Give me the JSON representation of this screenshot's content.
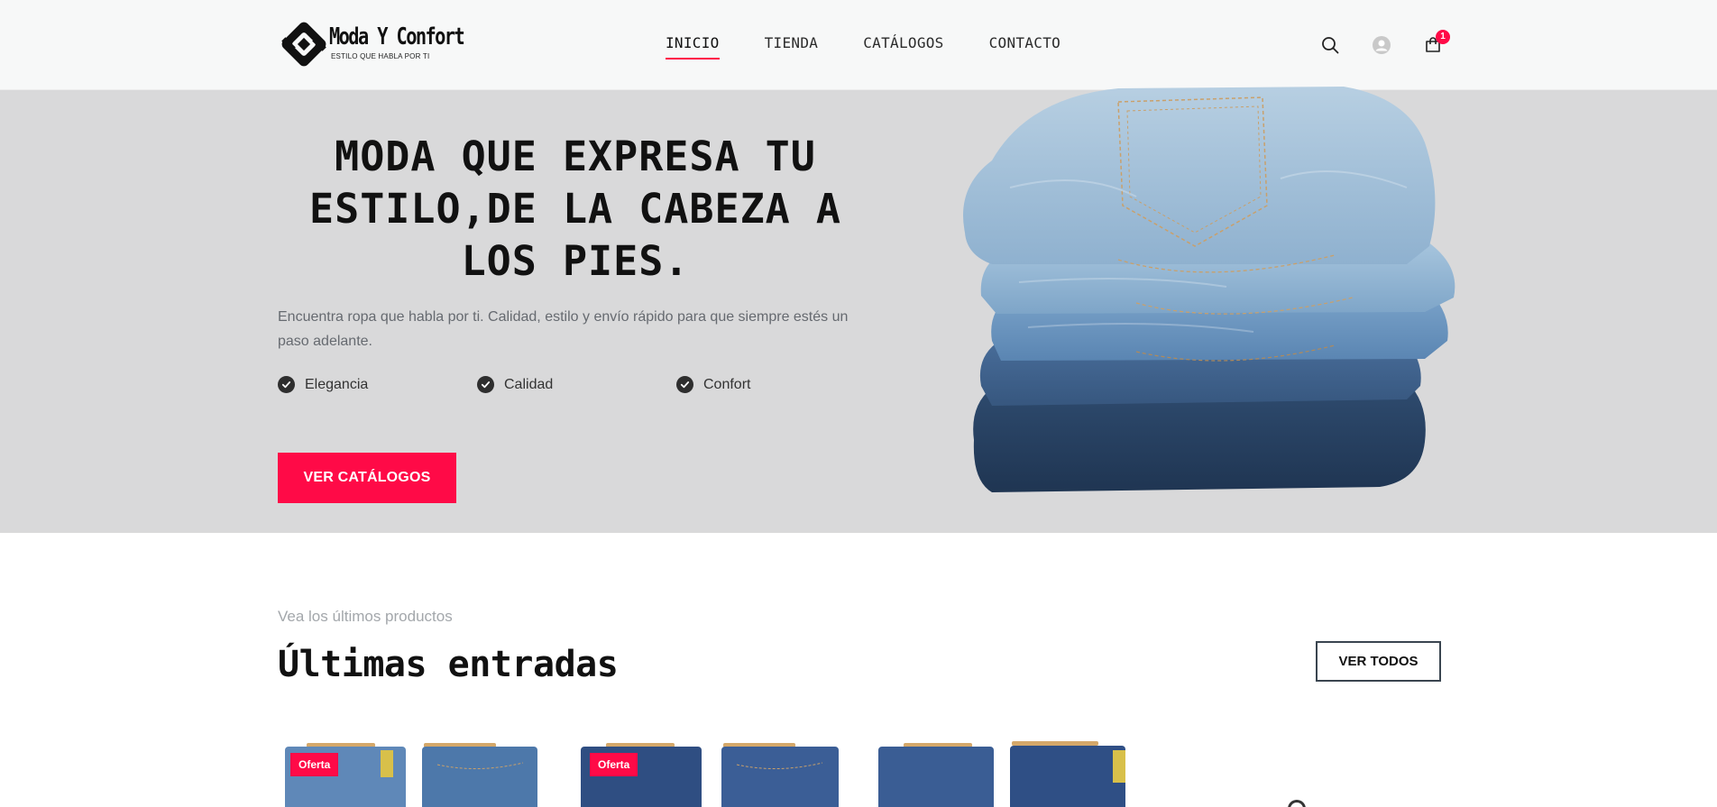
{
  "header": {
    "logo": {
      "title": "Moda Y Confort",
      "tagline": "ESTILO QUE HABLA POR TI"
    },
    "nav": [
      {
        "label": "INICIO",
        "active": true
      },
      {
        "label": "TIENDA",
        "active": false
      },
      {
        "label": "CATÁLOGOS",
        "active": false
      },
      {
        "label": "CONTACTO",
        "active": false
      }
    ],
    "icons": [
      "search-icon",
      "user-avatar-icon",
      "shopping-bag-icon"
    ],
    "cart_count": "1"
  },
  "hero": {
    "title": "MODA QUE EXPRESA TU ESTILO,DE LA CABEZA A LOS PIES.",
    "description": "Encuentra ropa que habla por ti. Calidad, estilo y envío rápido para que siempre estés un paso adelante.",
    "features": [
      "Elegancia",
      "Calidad",
      "Confort"
    ],
    "cta_label": "VER CATÁLOGOS",
    "image": "stacked-jeans"
  },
  "latest": {
    "subtitle": "Vea los últimos productos",
    "title": "Últimas entradas",
    "view_all_label": "VER TODOS",
    "products": [
      {
        "badge": "Oferta",
        "image": "jeans-pair"
      },
      {
        "badge": "Oferta",
        "image": "jeans-pair"
      },
      {
        "badge": "",
        "image": "jeans-pair"
      }
    ]
  },
  "colors": {
    "accent": "#ff0a47",
    "header_bg": "#f7f8f8",
    "hero_bg": "#d9d9da",
    "text_dark": "#111111",
    "text_muted": "#666a70"
  }
}
